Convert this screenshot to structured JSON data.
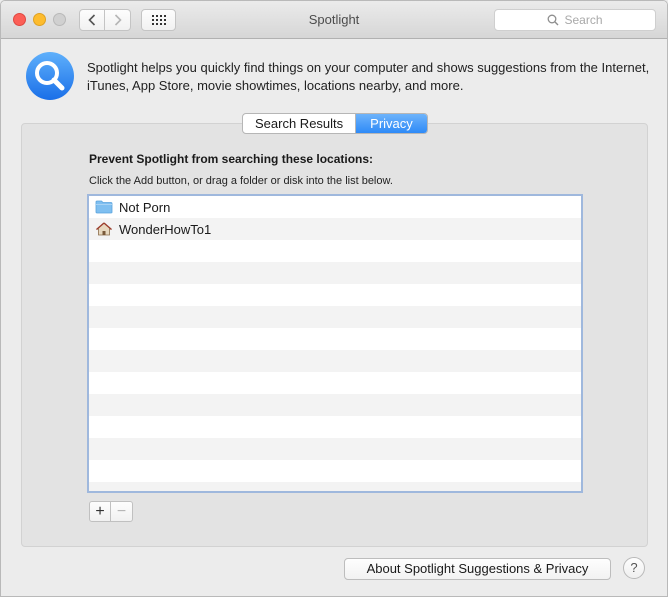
{
  "window": {
    "title": "Spotlight"
  },
  "toolbar": {
    "search_placeholder": "Search",
    "back_icon": "chevron-left-icon",
    "forward_icon": "chevron-right-icon",
    "grid_icon": "show-all-grid-icon"
  },
  "header": {
    "icon": "spotlight-magnifier-icon",
    "description": "Spotlight helps you quickly find things on your computer and shows suggestions from the Internet, iTunes, App Store, movie showtimes, locations nearby, and more."
  },
  "tabs": [
    {
      "label": "Search Results",
      "active": false
    },
    {
      "label": "Privacy",
      "active": true
    }
  ],
  "privacy": {
    "heading": "Prevent Spotlight from searching these locations:",
    "instructions": "Click the Add button, or drag a folder or disk into the list below.",
    "items": [
      {
        "label": "Not Porn",
        "icon": "folder-icon"
      },
      {
        "label": "WonderHowTo1",
        "icon": "home-icon"
      }
    ],
    "add_label": "+",
    "remove_label": "−"
  },
  "footer": {
    "about_label": "About Spotlight Suggestions & Privacy",
    "help_label": "?"
  },
  "colors": {
    "accent": "#2e8af7",
    "close": "#fc5f57",
    "minimize": "#fdbc2e",
    "list_border": "#9fb8dd"
  }
}
